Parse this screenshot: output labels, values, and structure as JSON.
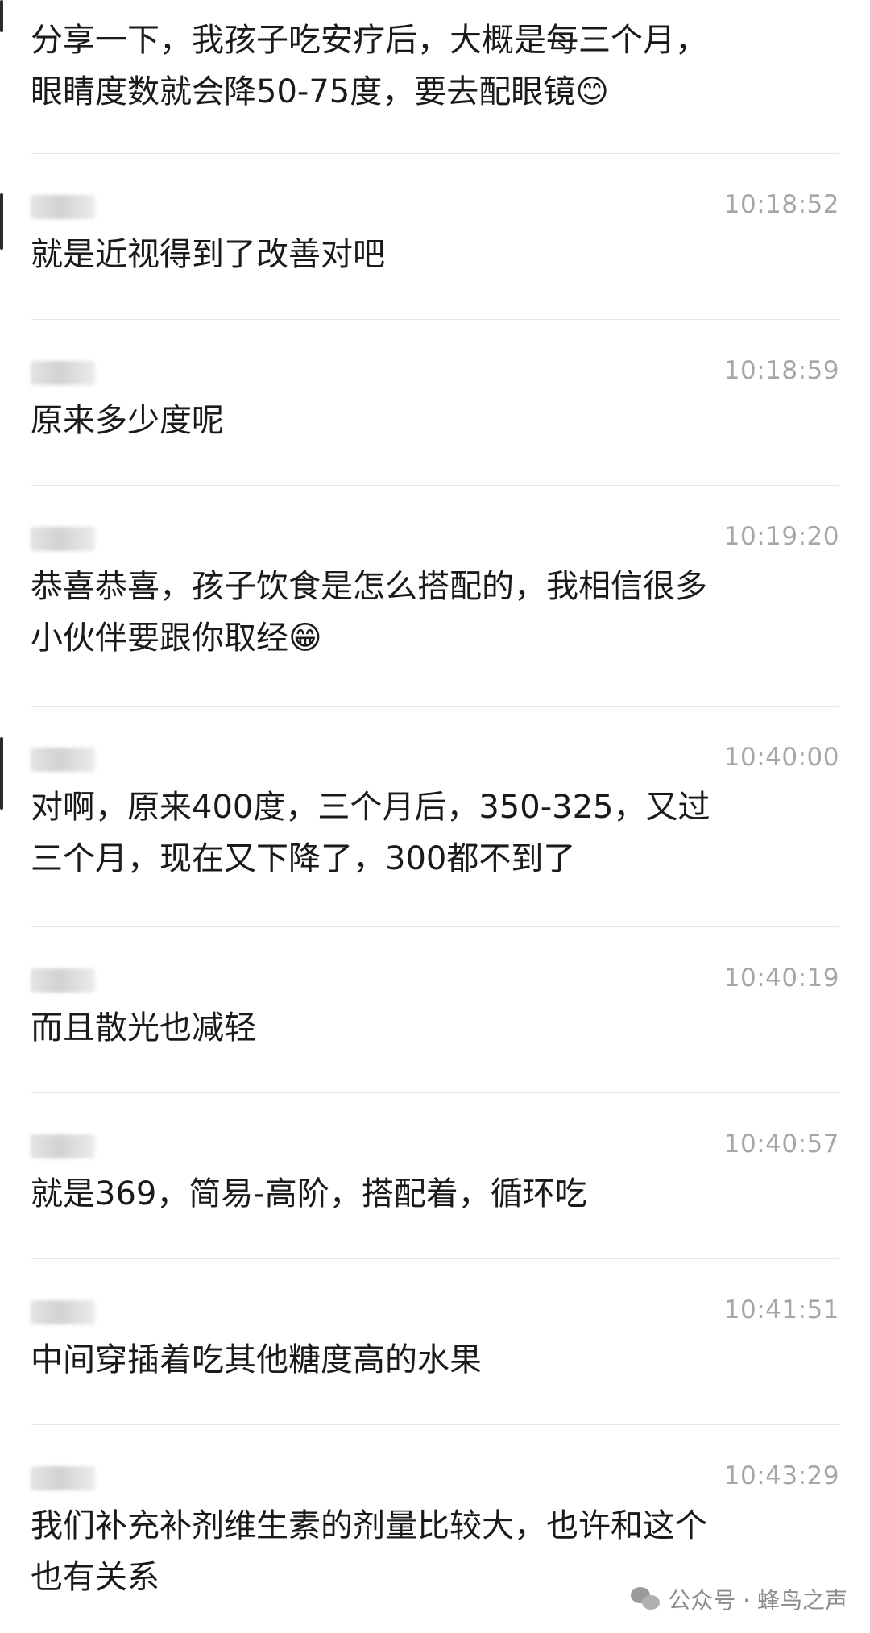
{
  "messages": [
    {
      "time": "",
      "text": "分享一下，我孩子吃安疗后，大概是每三个月，\n眼睛度数就会降50-75度，要去配眼镜",
      "emoji": "😊"
    },
    {
      "time": "10:18:52",
      "text": "就是近视得到了改善对吧",
      "emoji": ""
    },
    {
      "time": "10:18:59",
      "text": "原来多少度呢",
      "emoji": ""
    },
    {
      "time": "10:19:20",
      "text": "恭喜恭喜，孩子饮食是怎么搭配的，我相信很多\n小伙伴要跟你取经",
      "emoji": "😁"
    },
    {
      "time": "10:40:00",
      "text": "对啊，原来400度，三个月后，350-325，又过\n三个月，现在又下降了，300都不到了",
      "emoji": ""
    },
    {
      "time": "10:40:19",
      "text": "而且散光也减轻",
      "emoji": ""
    },
    {
      "time": "10:40:57",
      "text": "就是369，简易-高阶，搭配着，循环吃",
      "emoji": ""
    },
    {
      "time": "10:41:51",
      "text": "中间穿插着吃其他糖度高的水果",
      "emoji": ""
    },
    {
      "time": "10:43:29",
      "text": "我们补充补剂维生素的剂量比较大，也许和这个\n也有关系",
      "emoji": ""
    }
  ],
  "watermark": {
    "text": "公众号 · 蜂鸟之声",
    "icon": "wechat-icon"
  }
}
